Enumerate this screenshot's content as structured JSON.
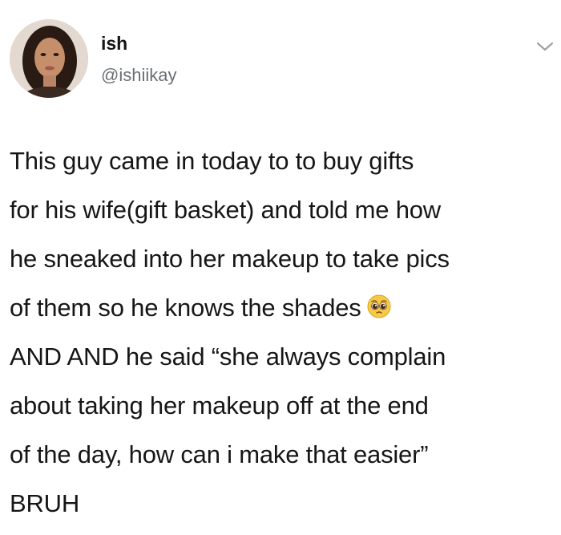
{
  "tweet": {
    "display_name": "ish",
    "handle": "@ishiikay",
    "lines": [
      "This guy came in today to to buy gifts",
      "for his wife(gift basket) and told me how",
      "he sneaked into her makeup to take pics",
      "of them so he knows the shades",
      "AND AND he said “she always complain",
      "about taking her makeup off at the end",
      "of the day, how can i make that easier”",
      "BRUH"
    ],
    "emoji": "pleading-face-icon"
  },
  "colors": {
    "text": "#161616",
    "handle": "#6a6f74",
    "caret": "#9aa3ab",
    "background": "#ffffff"
  }
}
